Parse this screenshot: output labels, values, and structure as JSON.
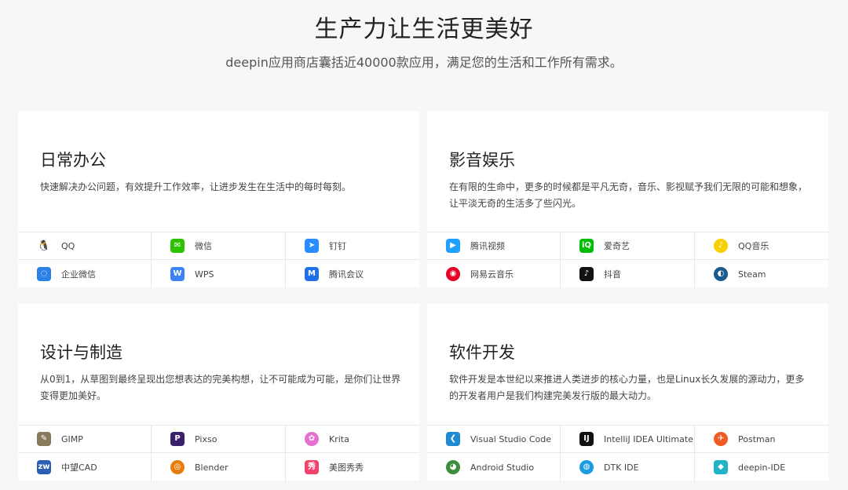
{
  "hero": {
    "title": "生产力让生活更美好",
    "subtitle": "deepin应用商店囊括近40000款应用，满足您的生活和工作所有需求。"
  },
  "cards": [
    {
      "title": "日常办公",
      "description": "快速解决办公问题，有效提升工作效率，让进步发生在生活中的每时每刻。",
      "apps": [
        {
          "label": "QQ",
          "icon": "qq-icon",
          "glyph": "🐧",
          "color": "#ffffff"
        },
        {
          "label": "微信",
          "icon": "wechat-icon",
          "glyph": "✉",
          "color": "#2dc100"
        },
        {
          "label": "钉钉",
          "icon": "dingtalk-icon",
          "glyph": "➤",
          "color": "#2a8dff"
        },
        {
          "label": "企业微信",
          "icon": "wecom-icon",
          "glyph": "◌",
          "color": "#2b82e4"
        },
        {
          "label": "WPS",
          "icon": "wps-icon",
          "glyph": "W",
          "color": "#3c82f5"
        },
        {
          "label": "腾讯会议",
          "icon": "tencent-meeting-icon",
          "glyph": "M",
          "color": "#1f6fe8"
        }
      ]
    },
    {
      "title": "影音娱乐",
      "description": "在有限的生命中，更多的时候都是平凡无奇，音乐、影视赋予我们无限的可能和想象，让平淡无奇的生活多了些闪光。",
      "apps": [
        {
          "label": "腾讯视频",
          "icon": "tencent-video-icon",
          "glyph": "▶",
          "color": "#20a0ff"
        },
        {
          "label": "爱奇艺",
          "icon": "iqiyi-icon",
          "glyph": "iQ",
          "color": "#00be06"
        },
        {
          "label": "QQ音乐",
          "icon": "qq-music-icon",
          "glyph": "♪",
          "color": "#f7d000"
        },
        {
          "label": "网易云音乐",
          "icon": "netease-music-icon",
          "glyph": "◉",
          "color": "#e60026"
        },
        {
          "label": "抖音",
          "icon": "douyin-icon",
          "glyph": "♪",
          "color": "#111111"
        },
        {
          "label": "Steam",
          "icon": "steam-icon",
          "glyph": "◐",
          "color": "#1b5a8c"
        }
      ]
    },
    {
      "title": "设计与制造",
      "description": "从0到1，从草图到最终呈现出您想表达的完美构想，让不可能成为可能，是你们让世界变得更加美好。",
      "apps": [
        {
          "label": "GIMP",
          "icon": "gimp-icon",
          "glyph": "✎",
          "color": "#8a7a5c"
        },
        {
          "label": "Pixso",
          "icon": "pixso-icon",
          "glyph": "P",
          "color": "#3a1f6b"
        },
        {
          "label": "Krita",
          "icon": "krita-icon",
          "glyph": "✿",
          "color": "#e66fd1"
        },
        {
          "label": "中望CAD",
          "icon": "zwcad-icon",
          "glyph": "zw",
          "color": "#2b5fb3"
        },
        {
          "label": "Blender",
          "icon": "blender-icon",
          "glyph": "◎",
          "color": "#e87d0d"
        },
        {
          "label": "美图秀秀",
          "icon": "meitu-icon",
          "glyph": "秀",
          "color": "#f0426a"
        }
      ]
    },
    {
      "title": "软件开发",
      "description": "软件开发是本世纪以来推进人类进步的核心力量，也是Linux长久发展的源动力，更多的开发者用户是我们构建完美发行版的最大动力。",
      "apps": [
        {
          "label": "Visual Studio Code",
          "icon": "vscode-icon",
          "glyph": "❮",
          "color": "#1f8ad2"
        },
        {
          "label": "IntelliJ IDEA Ultimate",
          "icon": "intellij-icon",
          "glyph": "IJ",
          "color": "#111111"
        },
        {
          "label": "Postman",
          "icon": "postman-icon",
          "glyph": "✈",
          "color": "#ef5b25"
        },
        {
          "label": "Android Studio",
          "icon": "android-studio-icon",
          "glyph": "◕",
          "color": "#3b8e3e"
        },
        {
          "label": "DTK IDE",
          "icon": "dtk-ide-icon",
          "glyph": "◍",
          "color": "#1a9ae0"
        },
        {
          "label": "deepin-IDE",
          "icon": "deepin-ide-icon",
          "glyph": "◆",
          "color": "#20b4c8"
        }
      ]
    }
  ]
}
